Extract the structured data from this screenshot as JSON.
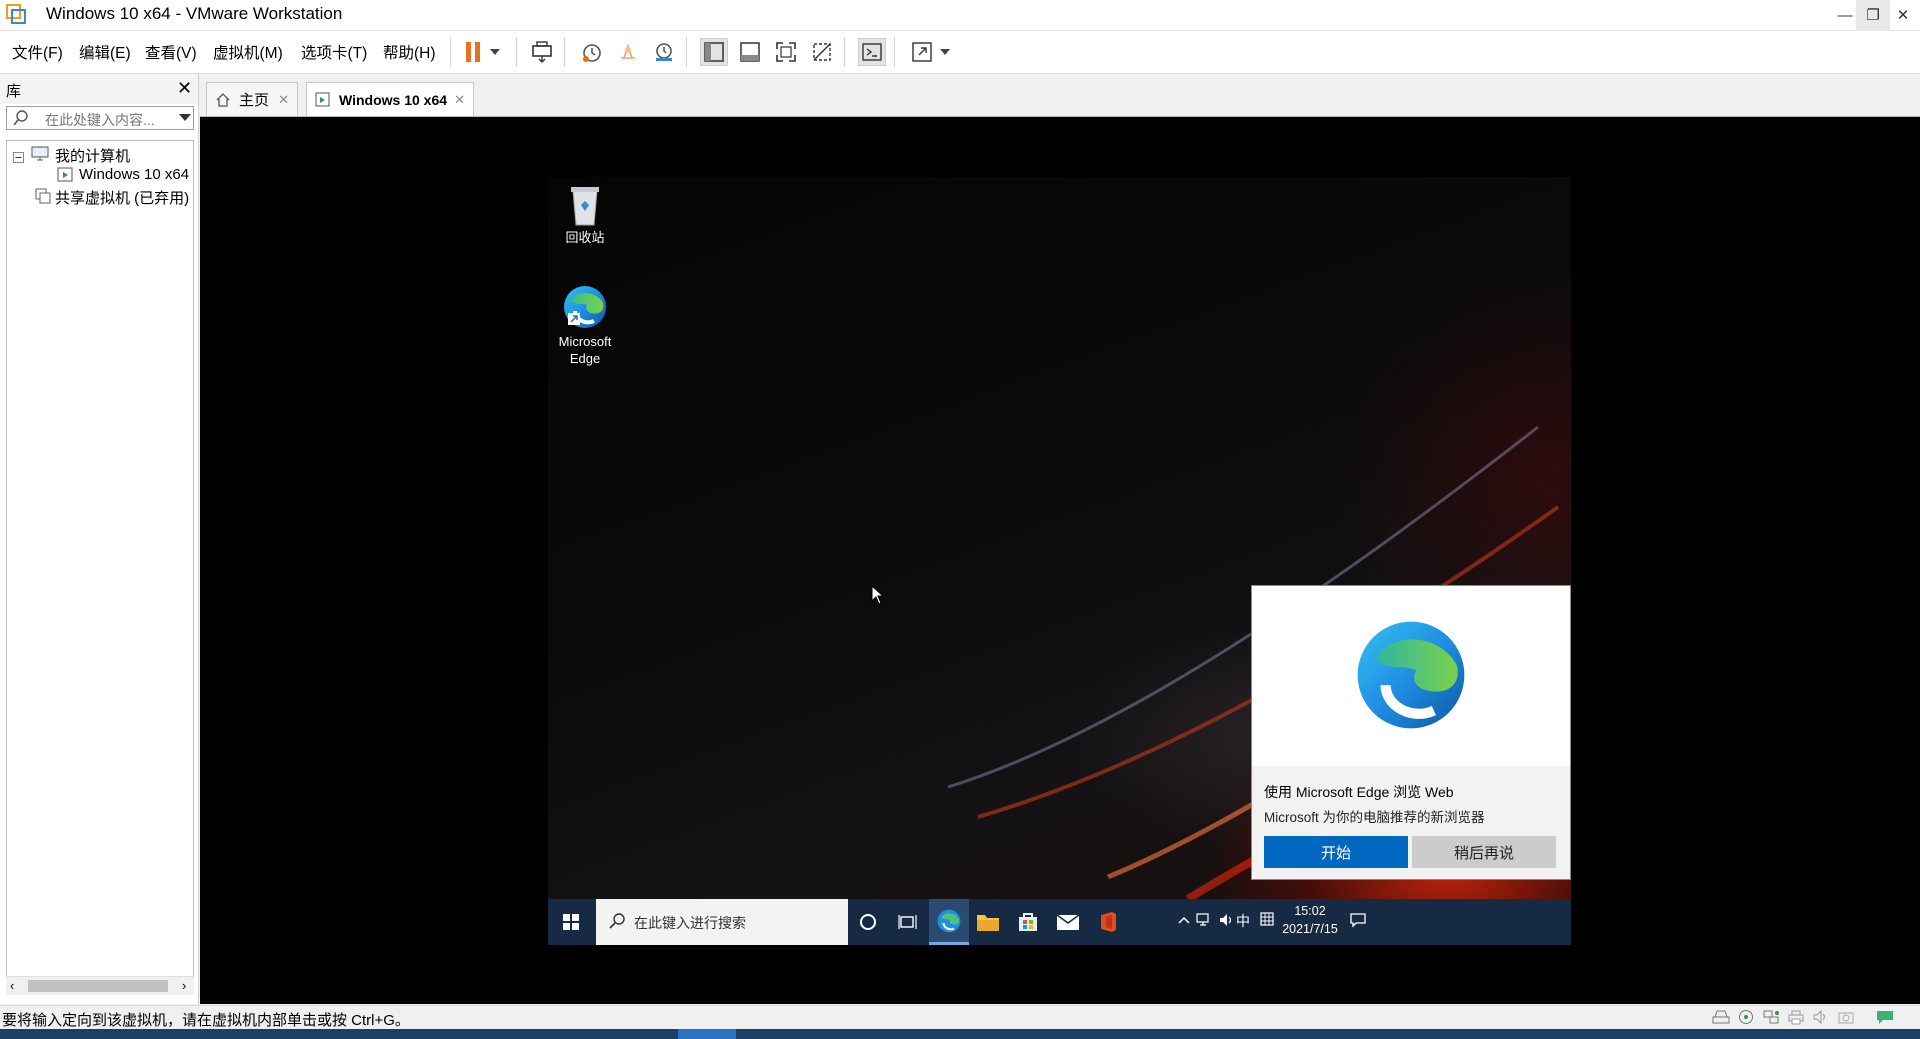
{
  "window": {
    "title": "Windows 10 x64 - VMware Workstation",
    "controls": {
      "minimize": "—",
      "restore": "❐",
      "close": "✕"
    }
  },
  "menu": [
    "文件(F)",
    "编辑(E)",
    "查看(V)",
    "虚拟机(M)",
    "选项卡(T)",
    "帮助(H)"
  ],
  "toolbar_icons": [
    "pause-icon",
    "dropdown-icon",
    "send-ctrl-alt-del-icon",
    "snapshot-take-icon",
    "snapshot-revert-icon",
    "snapshot-manager-icon",
    "show-library-icon",
    "thumbnail-bar-icon",
    "full-screen-icon",
    "unity-icon",
    "console-icon",
    "stretch-icon",
    "dropdown-icon"
  ],
  "library": {
    "title": "库",
    "close": "✕",
    "search_placeholder": "在此处键入内容...",
    "tree": {
      "root": "我的计算机",
      "vm": "Windows 10 x64",
      "shared": "共享虚拟机 (已弃用)"
    }
  },
  "tabs": [
    {
      "label": "主页",
      "close": "✕"
    },
    {
      "label": "Windows 10 x64",
      "close": "✕"
    }
  ],
  "guest": {
    "desktop_icons": [
      {
        "label": "回收站"
      },
      {
        "label": "Microsoft\nEdge"
      }
    ],
    "edge_popup": {
      "title": "使用 Microsoft Edge 浏览 Web",
      "subtitle": "Microsoft 为你的电脑推荐的新浏览器",
      "primary": "开始",
      "secondary": "稍后再说"
    },
    "taskbar": {
      "search_placeholder": "在此键入进行搜索",
      "ime": "中",
      "time": "15:02",
      "date": "2021/7/15"
    }
  },
  "status": {
    "text": "要将输入定向到该虚拟机，请在虚拟机内部单击或按 Ctrl+G。"
  },
  "colors": {
    "accent": "#0067c0",
    "pause": "#e8711d",
    "taskbar": "#162a43"
  }
}
